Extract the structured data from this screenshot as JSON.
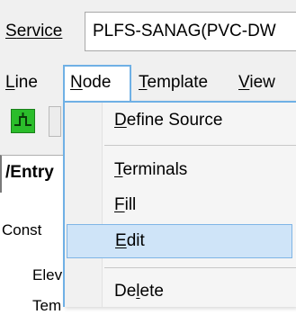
{
  "service": {
    "label_mnemonic": "S",
    "label_rest": "ervice",
    "value": "PLFS-SANAG(PVC-DW"
  },
  "menubar": {
    "items": [
      {
        "mnemonic": "L",
        "rest": "ine"
      },
      {
        "mnemonic": "N",
        "rest": "ode"
      },
      {
        "mnemonic": "T",
        "rest": "emplate"
      },
      {
        "mnemonic": "V",
        "rest": "iew"
      }
    ]
  },
  "toolbar": {
    "tool_icon": "network-node-icon",
    "tool_color": "#2bbd2b"
  },
  "tabs": {
    "active": "/Entry"
  },
  "content": {
    "label_const": "Const",
    "label_elev": "Elev",
    "label_tem": "Tem"
  },
  "node_menu": {
    "items": [
      {
        "pre": "",
        "mnemonic": "D",
        "rest": "efine Source"
      },
      {
        "pre": "",
        "mnemonic": "T",
        "rest": "erminals"
      },
      {
        "pre": "",
        "mnemonic": "F",
        "rest": "ill"
      },
      {
        "pre": "",
        "mnemonic": "E",
        "rest": "dit"
      },
      {
        "pre": "De",
        "mnemonic": "l",
        "rest": "ete"
      }
    ],
    "highlighted": "Edit",
    "highlight_color": "#cfe4f8",
    "accent_color": "#6fb0e5"
  }
}
